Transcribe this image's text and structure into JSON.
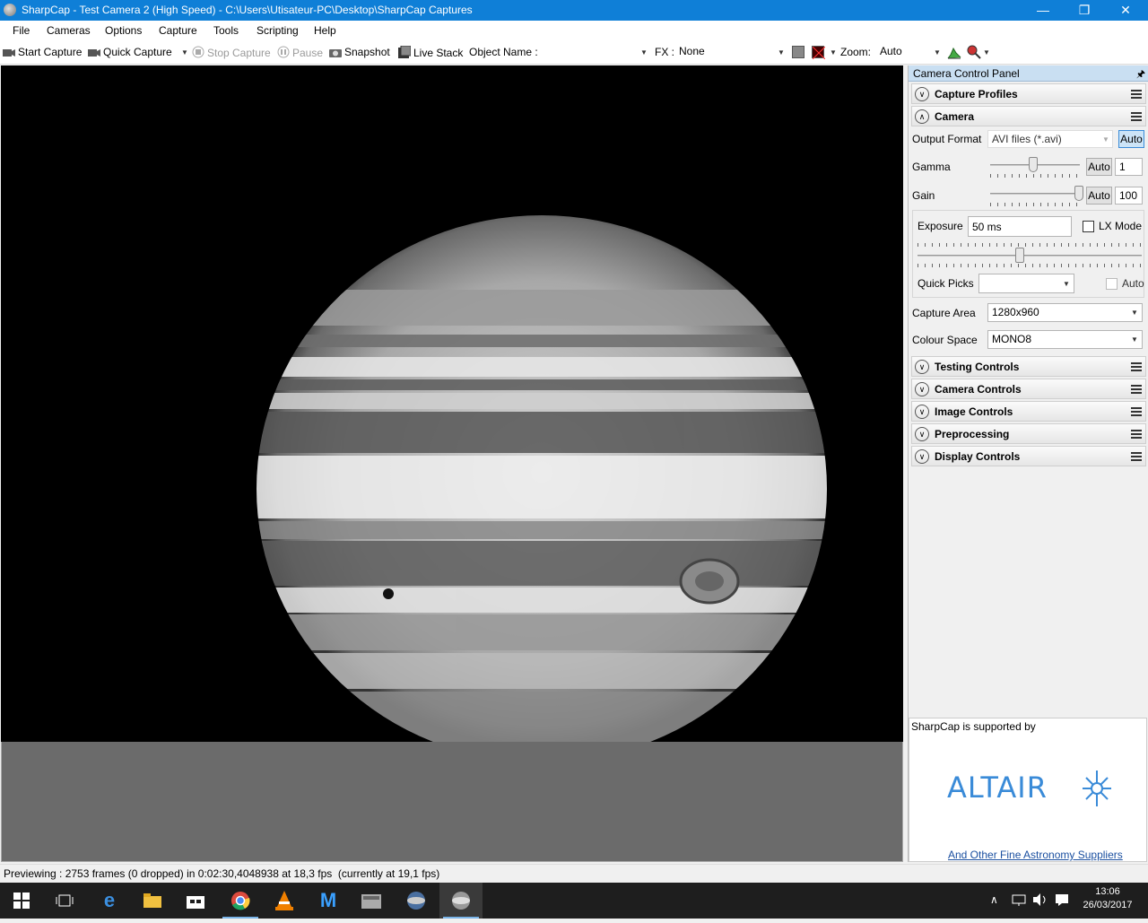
{
  "window": {
    "title": "SharpCap - Test Camera 2 (High Speed) - C:\\Users\\Utisateur-PC\\Desktop\\SharpCap Captures",
    "minimize": "—",
    "restore": "❐",
    "close": "✕"
  },
  "menu": [
    "File",
    "Cameras",
    "Options",
    "Capture",
    "Tools",
    "Scripting",
    "Help"
  ],
  "toolbar": {
    "start_capture": "Start Capture",
    "quick_capture": "Quick Capture",
    "stop_capture": "Stop Capture",
    "pause": "Pause",
    "snapshot": "Snapshot",
    "live_stack": "Live Stack",
    "object_name_label": "Object Name :",
    "object_name_value": "",
    "fx_label": "FX :",
    "fx_value": "None",
    "zoom_label": "Zoom:",
    "zoom_value": "Auto"
  },
  "panel": {
    "title": "Camera Control Panel",
    "pin": "🖈",
    "sections": {
      "capture_profiles": "Capture Profiles",
      "camera": "Camera",
      "testing_controls": "Testing Controls",
      "camera_controls": "Camera Controls",
      "image_controls": "Image Controls",
      "preprocessing": "Preprocessing",
      "display_controls": "Display Controls"
    },
    "camera": {
      "output_format_label": "Output Format",
      "output_format_value": "AVI files (*.avi)",
      "output_format_auto": "Auto",
      "gamma_label": "Gamma",
      "gamma_auto": "Auto",
      "gamma_value": "1",
      "gain_label": "Gain",
      "gain_auto": "Auto",
      "gain_value": "100",
      "exposure_label": "Exposure",
      "exposure_value": "50 ms",
      "lx_mode_label": "LX Mode",
      "quick_picks_label": "Quick Picks",
      "quick_picks_value": "",
      "quick_picks_auto": "Auto",
      "capture_area_label": "Capture Area",
      "capture_area_value": "1280x960",
      "colour_space_label": "Colour Space",
      "colour_space_value": "MONO8"
    },
    "sponsor": {
      "text": "SharpCap is supported by",
      "logo": "ALTAIR",
      "link": "And Other Fine Astronomy Suppliers"
    }
  },
  "status": "Previewing : 2753 frames (0 dropped) in 0:02:30,4048938 at 18,3 fps  (currently at 19,1 fps)",
  "taskbar": {
    "time": "13:06",
    "date": "26/03/2017"
  },
  "colors": {
    "titlebar": "#0f7fd7",
    "taskbar": "#1e1e1e",
    "accent": "#3a8bd8"
  }
}
